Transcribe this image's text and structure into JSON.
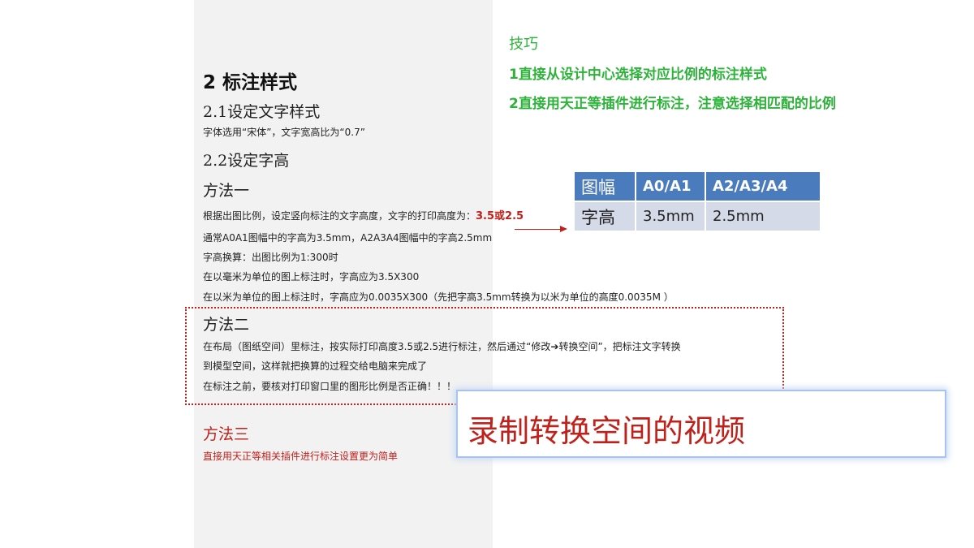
{
  "left": {
    "section_title": "2 标注样式",
    "sub1_title": "2.1设定文字样式",
    "sub1_text": "字体选用“宋体”，文字宽高比为“0.7”",
    "sub2_title": "2.2设定字高",
    "method1_title": "方法一",
    "method1_line1": "根据出图比例，设定竖向标注的文字高度，文字的打印高度为：",
    "method1_line1_value": "3.5或2.5",
    "method1_line2": "通常A0A1图幅中的字高为3.5mm，A2A3A4图幅中的字高2.5mm",
    "method1_line3": "字高换算：出图比例为1:300时",
    "method1_line4": "在以毫米为单位的图上标注时，字高应为3.5X300",
    "method1_line5": "在以米为单位的图上标注时，字高应为0.0035X300（先把字高3.5mm转换为以米为单位的高度0.0035M ）",
    "method2_title": "方法二",
    "method2_line1": "在布局（图纸空间）里标注，按实际打印高度3.5或2.5进行标注，然后通过“修改➔转换空间”，把标注文字转换",
    "method2_line2": "到模型空间，这样就把换算的过程交给电脑来完成了",
    "method2_line3": "在标注之前，要核对打印窗口里的图形比例是否正确！！！",
    "method3_title": "方法三",
    "method3_text": "直接用天正等相关插件进行标注设置更为简单"
  },
  "tips": {
    "title": "技巧",
    "tip1": "1直接从设计中心选择对应比例的标注样式",
    "tip2": "2直接用天正等插件进行标注，注意选择相匹配的比例"
  },
  "table": {
    "headers": [
      "图幅",
      "A0/A1",
      "A2/A3/A4"
    ],
    "row": [
      "字高",
      "3.5mm",
      "2.5mm"
    ]
  },
  "video_note": "录制转换空间的视频",
  "colors": {
    "accent_red": "#c0211b",
    "tip_green": "#2db33a",
    "table_header": "#4a7bbd",
    "table_cell": "#d4dae7"
  }
}
